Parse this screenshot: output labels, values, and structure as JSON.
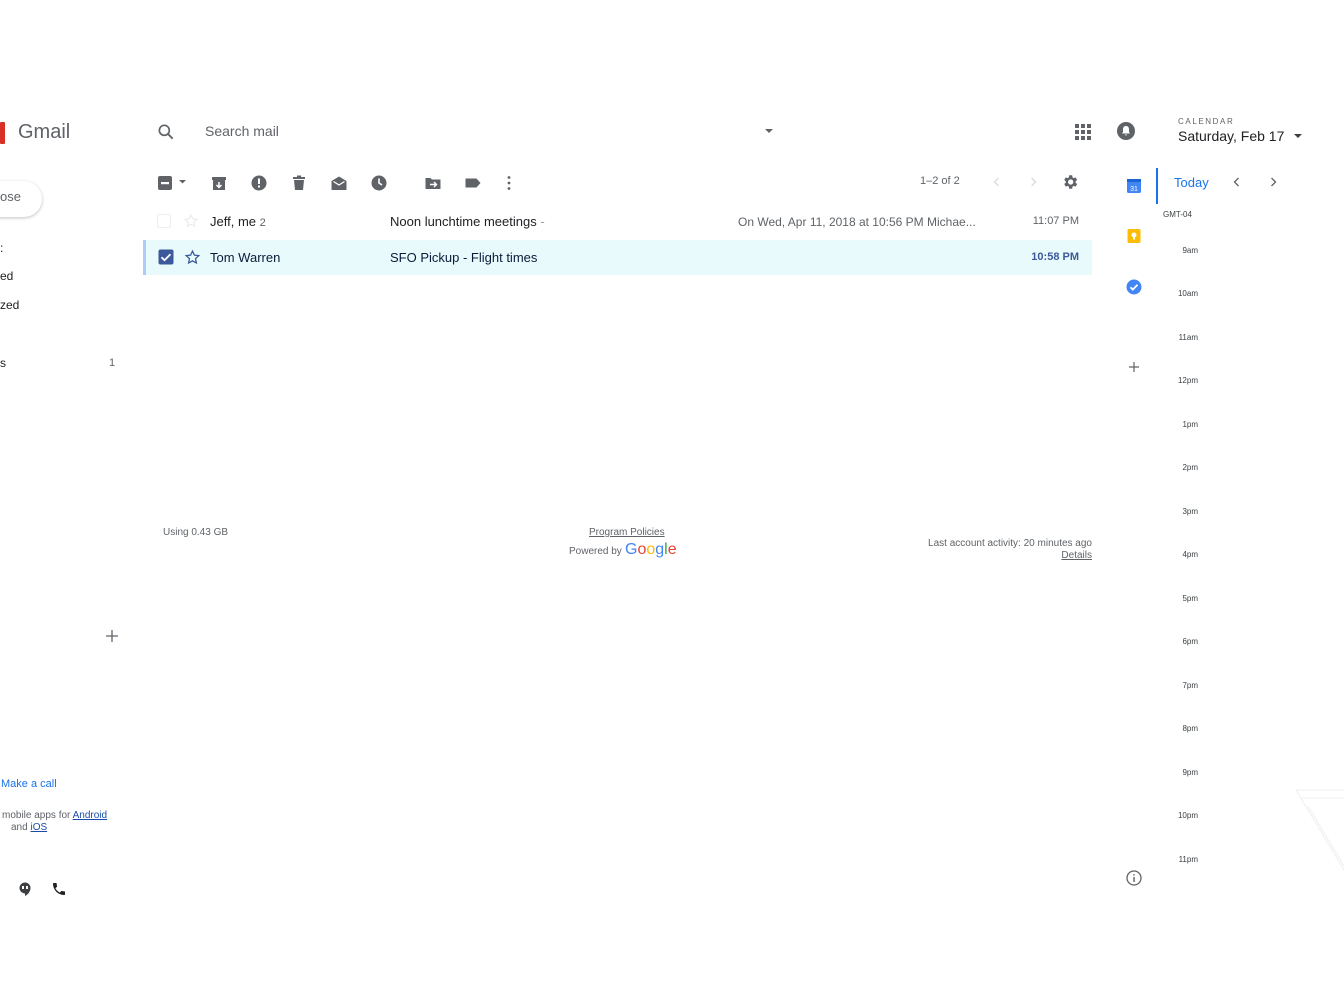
{
  "app": {
    "name": "Gmail"
  },
  "sidebar": {
    "compose_label": "ose",
    "items": [
      {
        "label": ":"
      },
      {
        "label": "ed"
      },
      {
        "label": "zed"
      },
      {
        "label": "s",
        "count": "1"
      }
    ],
    "make_call": "Make a call",
    "mobile_prefix": "mobile apps for",
    "android": "Android",
    "and": "and",
    "ios": "iOS"
  },
  "search": {
    "placeholder": "Search mail"
  },
  "toolbar": {
    "pager": "1–2 of 2"
  },
  "emails": [
    {
      "sender": "Jeff, me",
      "count": "2",
      "subject": "Noon lunchtime meetings",
      "sep": "-",
      "snippet": "On Wed, Apr 11, 2018 at 10:56 PM Michae...",
      "time": "11:07 PM",
      "checked": false,
      "starred": false
    },
    {
      "sender": "Tom Warren",
      "subject": "SFO Pickup",
      "sep": " - ",
      "snippet": "Flight times",
      "time": "10:58 PM",
      "checked": true,
      "starred": false
    }
  ],
  "footer": {
    "storage": "Using 0.43 GB",
    "program_policies": "Program Policies",
    "powered_by": "Powered by",
    "google": [
      "G",
      "o",
      "o",
      "g",
      "l",
      "e"
    ],
    "last_activity": "Last account activity: 20 minutes ago",
    "details": "Details"
  },
  "calendar": {
    "caption": "CALENDAR",
    "date": "Saturday, Feb 17",
    "today": "Today",
    "timezone": "GMT-04",
    "hours": [
      "9am",
      "10am",
      "11am",
      "12pm",
      "1pm",
      "2pm",
      "3pm",
      "4pm",
      "5pm",
      "6pm",
      "7pm",
      "8pm",
      "9pm",
      "10pm",
      "11pm"
    ]
  },
  "colors": {
    "accent": "#1a73e8",
    "selected_row": "#e8fafc",
    "brand_red": "#d93025"
  }
}
